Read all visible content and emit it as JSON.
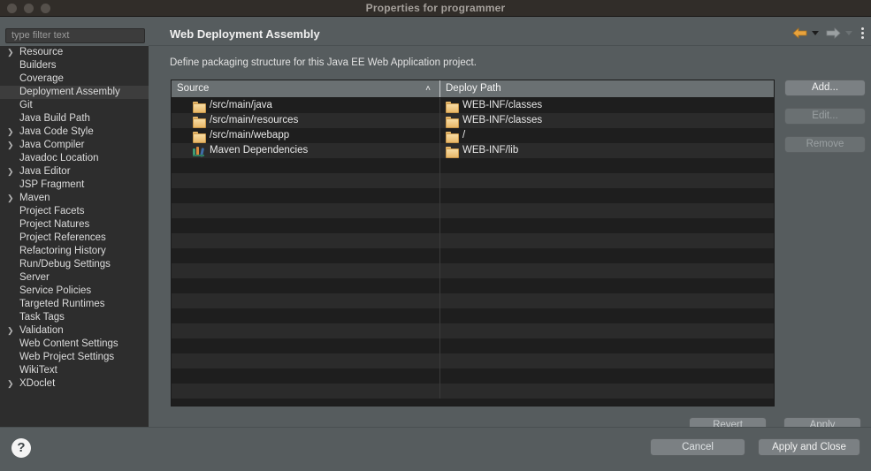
{
  "window": {
    "title": "Properties for programmer",
    "controls": [
      "close",
      "minimize",
      "maximize"
    ]
  },
  "sidebar": {
    "filter": {
      "placeholder": "type filter text",
      "value": ""
    },
    "items": [
      {
        "label": "Resource",
        "expandable": true,
        "selected": false
      },
      {
        "label": "Builders",
        "expandable": false,
        "selected": false
      },
      {
        "label": "Coverage",
        "expandable": false,
        "selected": false
      },
      {
        "label": "Deployment Assembly",
        "expandable": false,
        "selected": true
      },
      {
        "label": "Git",
        "expandable": false,
        "selected": false
      },
      {
        "label": "Java Build Path",
        "expandable": false,
        "selected": false
      },
      {
        "label": "Java Code Style",
        "expandable": true,
        "selected": false
      },
      {
        "label": "Java Compiler",
        "expandable": true,
        "selected": false
      },
      {
        "label": "Javadoc Location",
        "expandable": false,
        "selected": false
      },
      {
        "label": "Java Editor",
        "expandable": true,
        "selected": false
      },
      {
        "label": "JSP Fragment",
        "expandable": false,
        "selected": false
      },
      {
        "label": "Maven",
        "expandable": true,
        "selected": false
      },
      {
        "label": "Project Facets",
        "expandable": false,
        "selected": false
      },
      {
        "label": "Project Natures",
        "expandable": false,
        "selected": false
      },
      {
        "label": "Project References",
        "expandable": false,
        "selected": false
      },
      {
        "label": "Refactoring History",
        "expandable": false,
        "selected": false
      },
      {
        "label": "Run/Debug Settings",
        "expandable": false,
        "selected": false
      },
      {
        "label": "Server",
        "expandable": false,
        "selected": false
      },
      {
        "label": "Service Policies",
        "expandable": false,
        "selected": false
      },
      {
        "label": "Targeted Runtimes",
        "expandable": false,
        "selected": false
      },
      {
        "label": "Task Tags",
        "expandable": false,
        "selected": false
      },
      {
        "label": "Validation",
        "expandable": true,
        "selected": false
      },
      {
        "label": "Web Content Settings",
        "expandable": false,
        "selected": false
      },
      {
        "label": "Web Project Settings",
        "expandable": false,
        "selected": false
      },
      {
        "label": "WikiText",
        "expandable": false,
        "selected": false
      },
      {
        "label": "XDoclet",
        "expandable": true,
        "selected": false
      }
    ]
  },
  "page": {
    "title": "Web Deployment Assembly",
    "description": "Define packaging structure for this Java EE Web Application project.",
    "toolbar": {
      "back_icon": "back-arrow-icon",
      "forward_icon": "forward-arrow-icon",
      "menu_icon": "kebab-menu-icon"
    }
  },
  "table": {
    "columns": [
      "Source",
      "Deploy Path"
    ],
    "sort": {
      "column": "Source",
      "direction": "ascending",
      "glyph": "˄"
    },
    "rows": [
      {
        "icon": "folder-icon",
        "source": "/src/main/java",
        "deploy": "WEB-INF/classes",
        "deploy_icon": "folder-icon"
      },
      {
        "icon": "folder-icon",
        "source": "/src/main/resources",
        "deploy": "WEB-INF/classes",
        "deploy_icon": "folder-icon"
      },
      {
        "icon": "folder-icon",
        "source": "/src/main/webapp",
        "deploy": "/",
        "deploy_icon": "folder-icon"
      },
      {
        "icon": "books-icon",
        "source": "Maven Dependencies",
        "deploy": "WEB-INF/lib",
        "deploy_icon": "folder-icon"
      }
    ]
  },
  "side_buttons": [
    {
      "label": "Add...",
      "enabled": true
    },
    {
      "label": "Edit...",
      "enabled": false
    },
    {
      "label": "Remove",
      "enabled": false
    }
  ],
  "mid_buttons": [
    {
      "label": "Revert",
      "enabled": false
    },
    {
      "label": "Apply",
      "enabled": false
    }
  ],
  "footer": {
    "help_glyph": "?",
    "cancel_label": "Cancel",
    "apply_close_label": "Apply and Close"
  },
  "colors": {
    "titlebar": "#312d29",
    "panel": "#565c5e",
    "tree_bg": "#2d2d2d",
    "table_row_odd": "#1e1e1e",
    "table_row_even": "#2b2b2b",
    "table_header": "#6a7072",
    "accent_folder": "#e8b869",
    "accent_back_arrow": "#e8a33d"
  }
}
